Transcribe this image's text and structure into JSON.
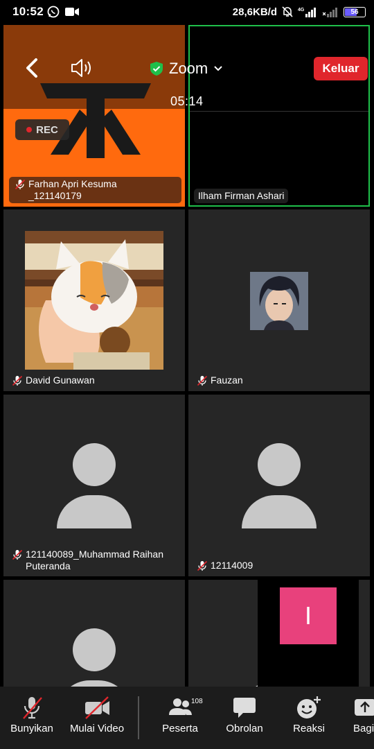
{
  "status_bar": {
    "time": "10:52",
    "net_speed": "28,6KB/d",
    "battery": "56",
    "network": "4G"
  },
  "meeting": {
    "title": "Zoom",
    "leave_label": "Keluar",
    "timer": "05:14",
    "rec_label": "REC",
    "accent_green": "#1fbf4a",
    "leave_color": "#e0262c"
  },
  "participants": [
    {
      "name": "Farhan Apri Kesuma",
      "name_line2": "_121140179",
      "muted": true
    },
    {
      "name": "Ilham Firman Ashari",
      "muted": false,
      "active_speaker": true
    },
    {
      "name": "David Gunawan",
      "muted": true
    },
    {
      "name": "Fauzan",
      "muted": true
    },
    {
      "name": "121140089_Muhammad Raihan",
      "name_line2": "Puteranda",
      "muted": true
    },
    {
      "name": "12114009",
      "muted": true
    },
    {
      "name": "",
      "muted": false
    },
    {
      "name": "",
      "muted": false
    }
  ],
  "floating_initial": "I",
  "toolbar": {
    "audio_label": "Bunyikan",
    "video_label": "Mulai Video",
    "participants_label": "Peserta",
    "participants_count": "108",
    "chat_label": "Obrolan",
    "reactions_label": "Reaksi",
    "share_label": "Bagi"
  }
}
